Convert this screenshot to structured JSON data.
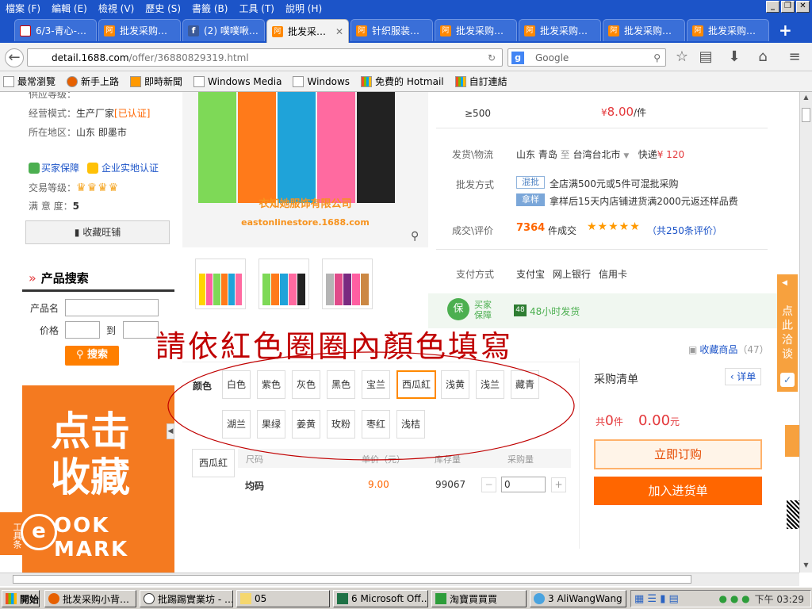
{
  "menubar": {
    "items": [
      "檔案 (F)",
      "編輯 (E)",
      "檢視 (V)",
      "歷史 (S)",
      "書籤 (B)",
      "工具 (T)",
      "說明 (H)"
    ]
  },
  "tabs": [
    {
      "label": "6/3-青心-…",
      "icon": "gmail-icon"
    },
    {
      "label": "批发采购…",
      "icon": "1688-icon"
    },
    {
      "label": "(2) 噗噗啾…",
      "icon": "facebook-icon"
    },
    {
      "label": "批发采…",
      "icon": "1688-icon",
      "active": true
    },
    {
      "label": "针织服装…",
      "icon": "1688-icon"
    },
    {
      "label": "批发采购…",
      "icon": "1688-icon"
    },
    {
      "label": "批发采购…",
      "icon": "1688-icon"
    },
    {
      "label": "批发采购…",
      "icon": "1688-icon"
    },
    {
      "label": "批发采购…",
      "icon": "1688-icon"
    }
  ],
  "url": {
    "host": "detail.1688.com",
    "path": "/offer/36880829319.html"
  },
  "search": {
    "placeholder": "Google"
  },
  "bookmarks": [
    "最常瀏覽",
    "新手上路",
    "即時新聞",
    "Windows Media",
    "Windows",
    "免費的 Hotmail",
    "自訂連結"
  ],
  "seller": {
    "partial_top": "供应等级：",
    "business_mode_label": "经营模式：",
    "business_mode_value": "生产厂家",
    "certified": "[已认证]",
    "region_label": "所在地区：",
    "region_value": "山东 即墨市",
    "buyer_protection": "买家保障",
    "verified": "企业实地认证",
    "trade_level_label": "交易等级：",
    "satisfaction_label": "满 意 度：",
    "satisfaction_value": "5",
    "save_shop": "收藏旺铺"
  },
  "product_search": {
    "title": "产品搜索",
    "name_label": "产品名",
    "price_label": "价格",
    "to": "到",
    "button": "搜索"
  },
  "promo": {
    "line1": "点击",
    "line2": "收藏",
    "line3": "OOK  MARK",
    "tool_label": "工具条"
  },
  "product_image": {
    "caption_cn": "衣知她服饰有限公司",
    "caption_en": "eastonlinestore.1688.com"
  },
  "pricing": {
    "qty": "≥500",
    "currency": "¥",
    "price": "8.00",
    "unit": "/件",
    "shipping_label": "发货\\物流",
    "from": "山东 青岛",
    "to_word": "至",
    "to_city": "台湾台北市",
    "express": "快递",
    "express_price": "¥ 120",
    "wholesale_label": "批发方式",
    "mix_tag": "混批",
    "mix_text": "全店满500元或5件可混批采购",
    "sample_tag": "拿样",
    "sample_text": "拿样后15天内店铺进货满2000元返还样品费",
    "deals_label": "成交\\评价",
    "deals_count": "7364",
    "deals_unit": "件成交",
    "reviews": "（共250条评价）",
    "pay_label": "支付方式",
    "pay_methods": [
      "支付宝",
      "网上银行",
      "信用卡"
    ],
    "guarantee": "买家保障",
    "ship48": "48小时发货"
  },
  "annotation": "請依紅色圈圈內顏色填寫",
  "favorites": {
    "label": "收藏商品",
    "count": "（47）"
  },
  "colors": {
    "label": "颜色",
    "options": [
      "白色",
      "紫色",
      "灰色",
      "黑色",
      "宝兰",
      "西瓜紅",
      "浅黄",
      "浅兰",
      "藏青",
      "湖兰",
      "果绿",
      "姜黄",
      "玫粉",
      "枣红",
      "浅桔"
    ],
    "selected": "西瓜紅"
  },
  "order_table": {
    "selected_color": "西瓜紅",
    "headers": [
      "尺码",
      "单价（元）",
      "库存量",
      "采购量"
    ],
    "row": {
      "size": "均码",
      "price": "9.00",
      "stock": "99067",
      "qty": "0"
    }
  },
  "cart": {
    "title": "采购清单",
    "detail": "‹ 详单",
    "total_prefix": "共",
    "total_count": "0",
    "total_unit": "件",
    "total_amount": "0.00",
    "amount_unit": "元",
    "order_now": "立即订购",
    "add_to_cart": "加入进货单"
  },
  "side_float": {
    "label": "点此洽谈"
  },
  "taskbar": {
    "start": "開始",
    "items": [
      "批发采购小背…",
      "批踢踢實業坊 - …",
      "05",
      "6 Microsoft Off…",
      "淘寶買買買",
      "3 AliWangWang"
    ],
    "clock": "下午 03:29"
  },
  "colors_theme": {
    "accent": "#ff6600",
    "brand_orange": "#ff8800",
    "title_blue": "#1c54c8",
    "annotation_red": "#c00000"
  }
}
